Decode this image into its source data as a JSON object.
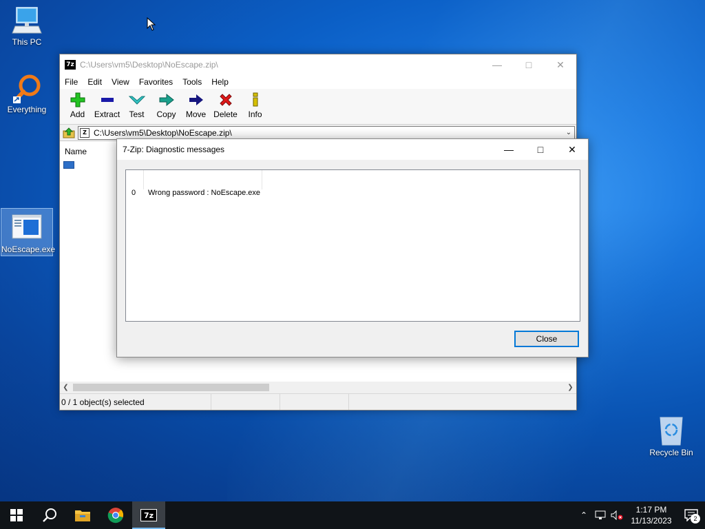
{
  "desktop": {
    "icons": [
      {
        "label": "This PC",
        "icon": "computer-icon"
      },
      {
        "label": "Everything",
        "icon": "everything-search-icon"
      },
      {
        "label": "NoEscape.exe",
        "icon": "exe-file-icon",
        "selected": true
      },
      {
        "label": "Recycle Bin",
        "icon": "recycle-bin-icon"
      }
    ]
  },
  "main_window": {
    "title": "C:\\Users\\vm5\\Desktop\\NoEscape.zip\\",
    "app_icon_text": "7z",
    "menu": [
      "File",
      "Edit",
      "View",
      "Favorites",
      "Tools",
      "Help"
    ],
    "toolbar": [
      {
        "label": "Add",
        "icon": "add-plus-icon",
        "color": "#1db31d"
      },
      {
        "label": "Extract",
        "icon": "extract-minus-icon",
        "color": "#1a1aa8"
      },
      {
        "label": "Test",
        "icon": "test-check-icon",
        "color": "#2ab0b0"
      },
      {
        "label": "Copy",
        "icon": "copy-arrow-icon",
        "color": "#1a9a8a"
      },
      {
        "label": "Move",
        "icon": "move-arrow-icon",
        "color": "#1a1a8a"
      },
      {
        "label": "Delete",
        "icon": "delete-x-icon",
        "color": "#d81a1a"
      },
      {
        "label": "Info",
        "icon": "info-icon",
        "color": "#c8b400"
      }
    ],
    "address": "C:\\Users\\vm5\\Desktop\\NoEscape.zip\\",
    "column_header": "Name",
    "status": "0 / 1 object(s) selected"
  },
  "dialog": {
    "title": "7-Zip: Diagnostic messages",
    "messages": [
      {
        "index": "0",
        "text": "Wrong password : NoEscape.exe"
      }
    ],
    "close_label": "Close"
  },
  "taskbar": {
    "apps": [
      "start-icon",
      "search-icon",
      "file-explorer-icon",
      "chrome-icon",
      "7zip-icon"
    ],
    "active_app_text": "7z",
    "time": "1:17 PM",
    "date": "11/13/2023",
    "notification_count": "2"
  }
}
